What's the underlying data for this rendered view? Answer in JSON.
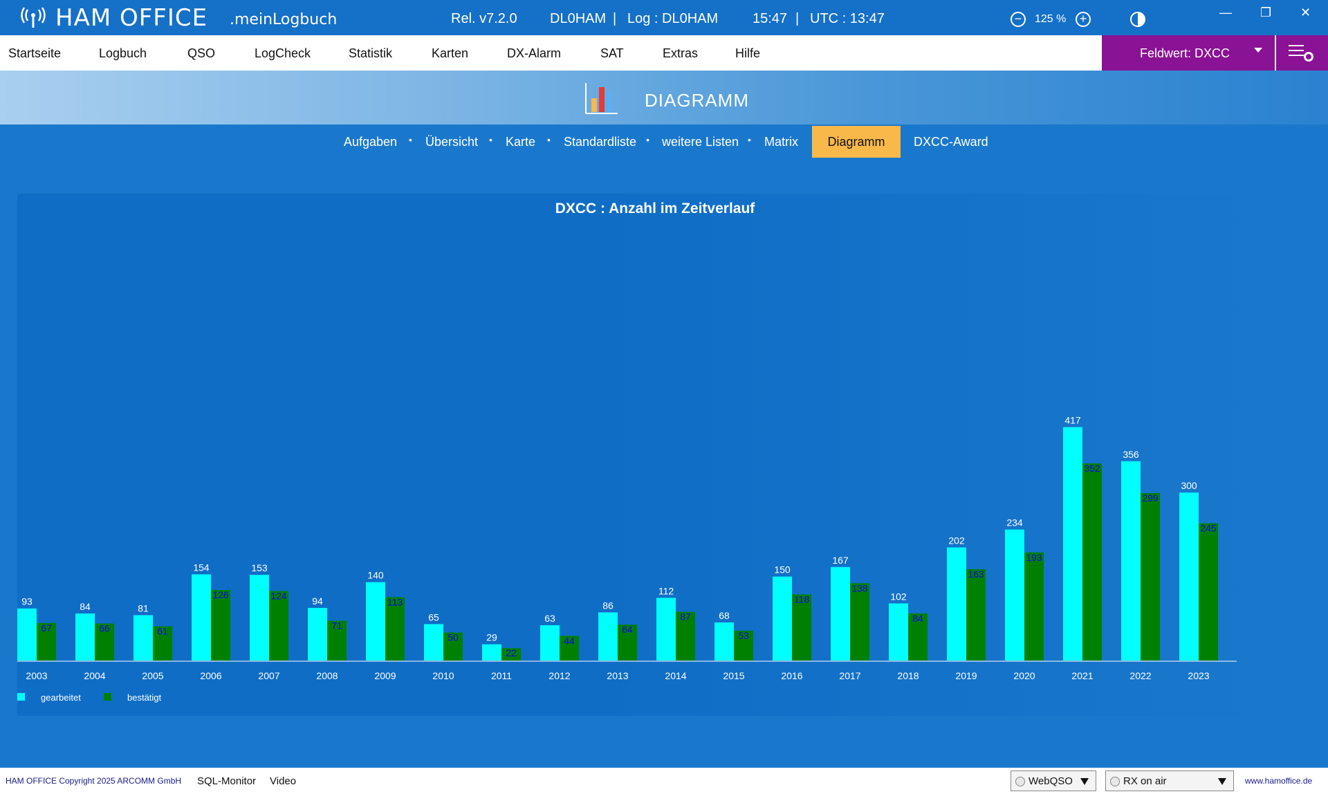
{
  "titlebar": {
    "app_name": "HAM OFFICE",
    "app_sub": ".meinLogbuch",
    "release": "Rel. v7.2.0",
    "callsign": "DL0HAM",
    "sep1": "|",
    "log": "Log : DL0HAM",
    "time": "15:47",
    "sep2": "|",
    "utc": "UTC : 13:47",
    "zoom_minus": "−",
    "zoom": "125 %",
    "zoom_plus": "+",
    "minimize": "—",
    "restore": "❐",
    "close": "✕"
  },
  "menu": {
    "items": [
      "Startseite",
      "Logbuch",
      "QSO",
      "LogCheck",
      "Statistik",
      "Karten",
      "DX-Alarm",
      "SAT",
      "Extras",
      "Hilfe"
    ],
    "field_label": "Feldwert:  DXCC"
  },
  "header": {
    "title": "DIAGRAMM"
  },
  "subtabs": {
    "items": [
      "Aufgaben",
      "Übersicht",
      "Karte",
      "Standardliste",
      "weitere Listen",
      "Matrix"
    ],
    "active": "Diagramm",
    "after": "DXCC-Award",
    "sep": "•"
  },
  "chart_data": {
    "type": "bar",
    "title": "DXCC : Anzahl im Zeitverlauf",
    "categories": [
      "2003",
      "2004",
      "2005",
      "2006",
      "2007",
      "2008",
      "2009",
      "2010",
      "2011",
      "2012",
      "2013",
      "2014",
      "2015",
      "2016",
      "2017",
      "2018",
      "2019",
      "2020",
      "2021",
      "2022",
      "2023"
    ],
    "series": [
      {
        "name": "gearbeitet",
        "color": "#00ffff",
        "label_color": "#ffffff",
        "values": [
          93,
          84,
          81,
          154,
          153,
          94,
          140,
          65,
          29,
          63,
          86,
          112,
          68,
          150,
          167,
          102,
          202,
          234,
          417,
          356,
          300
        ]
      },
      {
        "name": "bestätigt",
        "color": "#008000",
        "label_color": "#0000ff",
        "values": [
          67,
          66,
          61,
          126,
          124,
          71,
          113,
          50,
          22,
          44,
          64,
          87,
          53,
          118,
          138,
          84,
          163,
          193,
          352,
          299,
          245
        ]
      }
    ],
    "ylim": [
      0,
      417
    ],
    "grid": false,
    "legend": "bottom-left"
  },
  "statusbar": {
    "copyright": "HAM OFFICE Copyright 2025 ARCOMM GmbH",
    "sql": "SQL-Monitor",
    "video": "Video",
    "webqso": "WebQSO",
    "rx": "RX on air",
    "website": "www.hamoffice.de"
  }
}
